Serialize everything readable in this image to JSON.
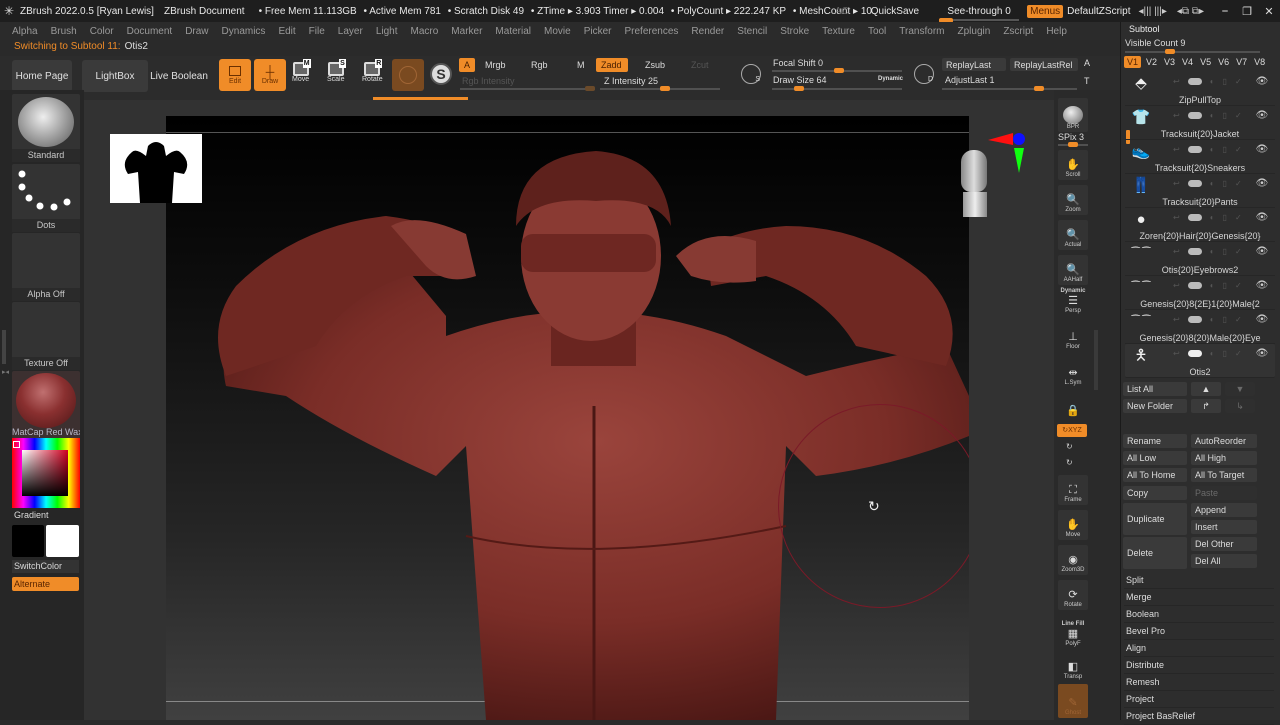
{
  "titlebar": {
    "app": "ZBrush 2022.0.5 [Ryan Lewis]",
    "document": "ZBrush Document",
    "stats": [
      "• Free Mem 11.113GB",
      "• Active Mem 781",
      "• Scratch Disk 49",
      "• ZTime ▸ 3.903 Timer ▸ 0.004",
      "• PolyCount ▸ 222.247 KP",
      "• MeshCount ▸ 10"
    ],
    "ac": "AC",
    "quicksave": "QuickSave",
    "see_through": "See-through  0",
    "see_through_value": 0,
    "menus": "Menus",
    "script": "DefaultZScript",
    "icons": [
      "◂||| |||▸",
      "◂⧉ ⧉▸"
    ],
    "window_buttons": [
      "minimize-icon",
      "restore-icon",
      "close-icon"
    ]
  },
  "menubar": [
    "Alpha",
    "Brush",
    "Color",
    "Document",
    "Draw",
    "Dynamics",
    "Edit",
    "File",
    "Layer",
    "Light",
    "Macro",
    "Marker",
    "Material",
    "Movie",
    "Picker",
    "Preferences",
    "Render",
    "Stencil",
    "Stroke",
    "Texture",
    "Tool",
    "Transform",
    "Zplugin",
    "Zscript",
    "Help"
  ],
  "notice": {
    "label": "Switching to Subtool 11:",
    "value": "Otis2"
  },
  "toolbar": {
    "home_page": "Home Page",
    "lightbox": "LightBox",
    "live_boolean": "Live Boolean",
    "edit": "Edit",
    "draw": "Draw",
    "move": "Move",
    "scale": "Scale",
    "rotate": "Rotate",
    "a": "A",
    "mrgb": "Mrgb",
    "rgb": "Rgb",
    "m": "M",
    "rgb_intensity": "Rgb Intensity",
    "zadd": "Zadd",
    "zsub": "Zsub",
    "zcut": "Zcut",
    "z_intensity": "Z Intensity 25",
    "z_intensity_value": 25,
    "focal_shift": "Focal Shift 0",
    "focal_shift_value": 0,
    "draw_size": "Draw Size 64",
    "draw_size_value": 64,
    "dynamic": "Dynamic",
    "replay_last": "ReplayLast",
    "replay_last_rel": "ReplayLastRel",
    "adjust_last": "AdjustLast 1",
    "a_cut": "A",
    "t_cut": "T"
  },
  "leftpanel": {
    "brush": "Standard",
    "stroke": "Dots",
    "alpha": "Alpha Off",
    "texture": "Texture Off",
    "material": "MatCap Red Wax",
    "gradient": "Gradient",
    "switch_color": "SwitchColor",
    "alternate": "Alternate"
  },
  "rightstrip": [
    {
      "label": "BPR",
      "icon": "bpr-icon"
    },
    {
      "label": "SPix 3",
      "icon": ""
    },
    {
      "label": "Scroll",
      "icon": "hand-scroll-icon"
    },
    {
      "label": "Zoom",
      "icon": "zoom-icon"
    },
    {
      "label": "Actual",
      "icon": "actual-size-icon"
    },
    {
      "label": "AAHalf",
      "icon": "aahalf-icon"
    },
    {
      "label": "Persp",
      "icon": "perspective-icon",
      "sub": "Dynamic"
    },
    {
      "label": "Floor",
      "icon": "floor-icon"
    },
    {
      "label": "L.Sym",
      "icon": "local-symmetry-icon"
    },
    {
      "label": "",
      "icon": "lock-icon"
    },
    {
      "label": "XYZ",
      "icon": "rotate-xyz-icon"
    },
    {
      "label": "Y",
      "icon": "rotate-y-icon"
    },
    {
      "label": "Z",
      "icon": "rotate-z-icon"
    },
    {
      "label": "Frame",
      "icon": "frame-icon"
    },
    {
      "label": "Move",
      "icon": "move-icon"
    },
    {
      "label": "Zoom3D",
      "icon": "zoom3d-icon"
    },
    {
      "label": "Rotate",
      "icon": "rotate-icon"
    },
    {
      "label": "PolyF",
      "icon": "polyframe-icon",
      "sub": "Line Fill"
    },
    {
      "label": "Transp",
      "icon": "transparency-icon"
    },
    {
      "label": "Ghost",
      "icon": "ghost-icon"
    }
  ],
  "subtool": {
    "title": "Subtool",
    "visible_count": "Visible Count 9",
    "visible_count_value": 9,
    "versions": [
      "V1",
      "V2",
      "V3",
      "V4",
      "V5",
      "V6",
      "V7",
      "V8"
    ],
    "active_version": "V1",
    "items": [
      {
        "name": "ZipPullTop",
        "thumb": "zipper-icon"
      },
      {
        "name": "Tracksuit{20}Jacket",
        "thumb": "jacket-icon"
      },
      {
        "name": "Tracksuit{20}Sneakers",
        "thumb": "sneakers-icon"
      },
      {
        "name": "Tracksuit{20}Pants",
        "thumb": "pants-icon"
      },
      {
        "name": "Zoren{20}Hair{20}Genesis{20}",
        "thumb": "hair-icon"
      },
      {
        "name": "Otis{20}Eyebrows2",
        "thumb": "eyebrows-icon"
      },
      {
        "name": "Genesis{20}8{2E}1{20}Male{2",
        "thumb": "eyebrows-icon"
      },
      {
        "name": "Genesis{20}8{20}Male{20}Eye",
        "thumb": "eyelashes-icon"
      },
      {
        "name": "Otis2",
        "thumb": "figure-icon",
        "selected": true
      }
    ],
    "list_all": "List All",
    "new_folder": "New Folder",
    "rename": "Rename",
    "auto_reorder": "AutoReorder",
    "all_low": "All Low",
    "all_high": "All High",
    "all_to_home": "All To Home",
    "all_to_target": "All To Target",
    "copy": "Copy",
    "paste": "Paste",
    "duplicate": "Duplicate",
    "append": "Append",
    "insert": "Insert",
    "delete": "Delete",
    "del_other": "Del Other",
    "del_all": "Del All",
    "sections": [
      "Split",
      "Merge",
      "Boolean",
      "Bevel Pro",
      "Align",
      "Distribute",
      "Remesh",
      "Project",
      "Project BasRelief"
    ]
  },
  "colors": {
    "accent": "#f08c28",
    "model": "#7a2d27",
    "panel": "#2d2d2d"
  }
}
